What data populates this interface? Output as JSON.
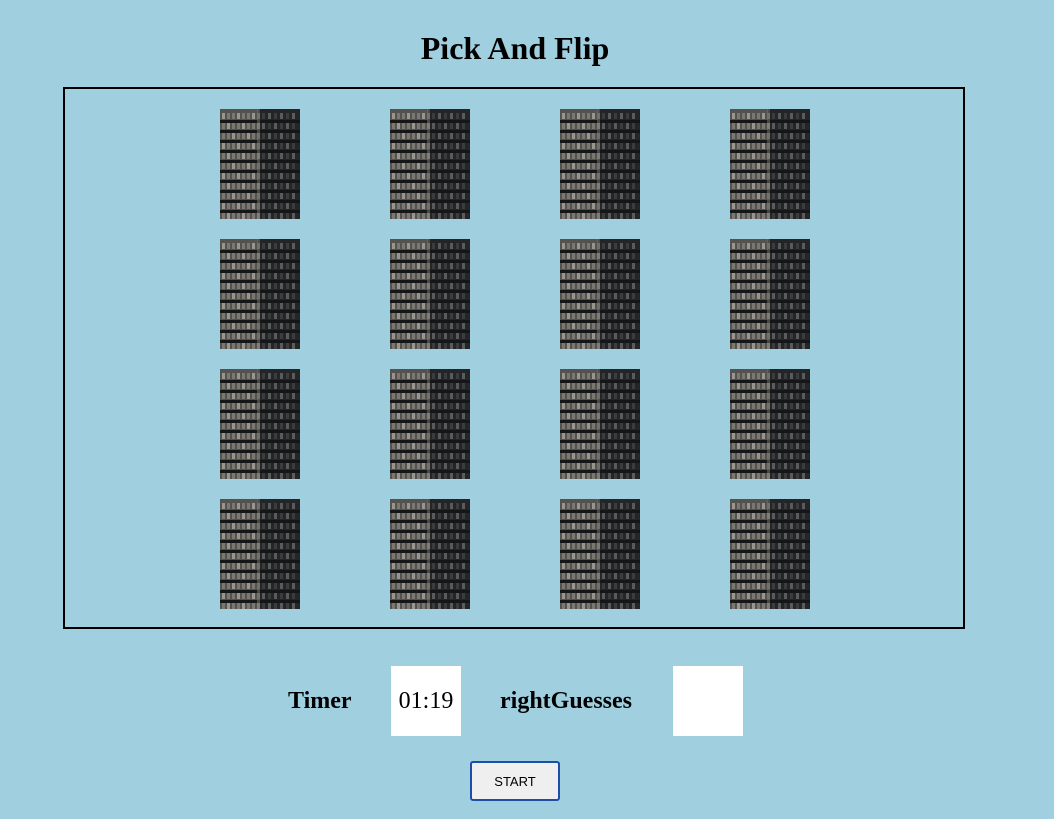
{
  "title": "Pick And Flip",
  "cards": {
    "count": 16,
    "face": "building-facade-image"
  },
  "timer": {
    "label": "Timer",
    "value": "01:19"
  },
  "right_guesses": {
    "label": "rightGuesses",
    "value": ""
  },
  "start_button": {
    "label": "START"
  },
  "colors": {
    "background": "#a0cfe0",
    "board_border": "#000000",
    "button_border": "#1d4fa8"
  }
}
